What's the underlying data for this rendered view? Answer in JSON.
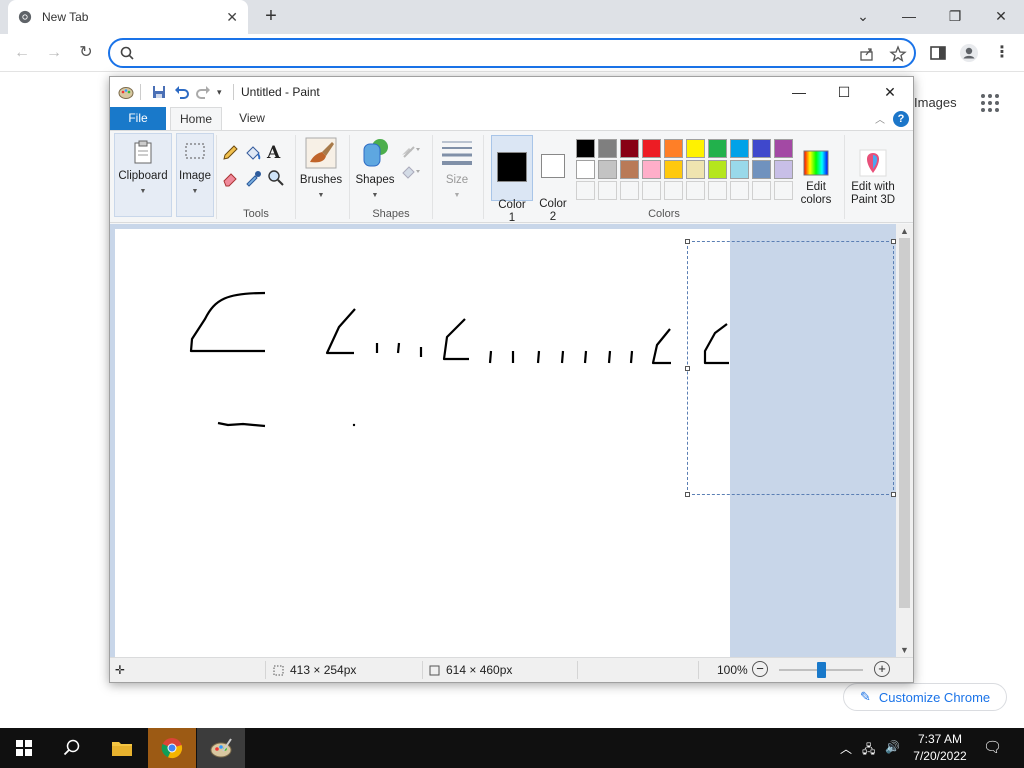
{
  "chrome": {
    "tab_title": "New Tab",
    "omnibox_placeholder": "",
    "images_link": "Images",
    "customize_label": "Customize Chrome"
  },
  "paint": {
    "title": "Untitled - Paint",
    "tabs": [
      "File",
      "Home",
      "View"
    ],
    "groups": {
      "clipboard": "Clipboard",
      "image": "Image",
      "tools": "Tools",
      "brushes": "Brushes",
      "shapes_btn": "Shapes",
      "shapes_group": "Shapes",
      "size": "Size",
      "color1": "Color\n1",
      "color2": "Color\n2",
      "colors": "Colors",
      "edit_colors": "Edit\ncolors",
      "edit_3d": "Edit with\nPaint 3D"
    },
    "palette_row1": [
      "#000000",
      "#7f7f7f",
      "#880015",
      "#ed1c24",
      "#ff7f27",
      "#fff200",
      "#22b14c",
      "#00a2e8",
      "#3f48cc",
      "#a349a4"
    ],
    "palette_row2": [
      "#ffffff",
      "#c3c3c3",
      "#b97a57",
      "#ffaec9",
      "#ffc90e",
      "#efe4b0",
      "#b5e61d",
      "#99d9ea",
      "#7092be",
      "#c8bfe7"
    ],
    "color1_value": "#000000",
    "color2_value": "#ffffff",
    "status": {
      "selection_size": "413 × 254px",
      "canvas_size": "614 × 460px",
      "zoom": "100%"
    }
  },
  "taskbar": {
    "time": "7:37 AM",
    "date": "7/20/2022"
  }
}
